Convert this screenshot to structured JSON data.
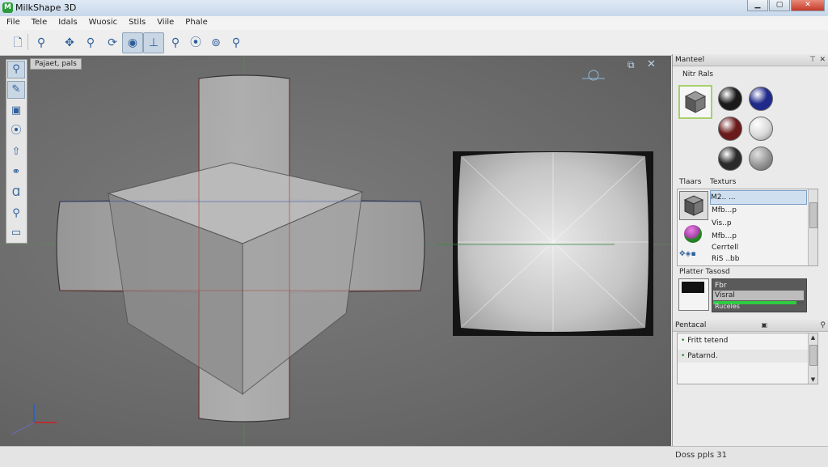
{
  "app": {
    "title": "MilkShape 3D",
    "logo": "M"
  },
  "window_buttons": {
    "minimize": "▁",
    "maximize": "▢",
    "close": "✕"
  },
  "menu": [
    "File",
    "Tele",
    "Idals",
    "Wuosic",
    "Stils",
    "Viile",
    "Phale"
  ],
  "toolbar": {
    "icons": [
      "new-file-icon",
      "select-icon",
      "move-icon",
      "search-icon",
      "rotate-icon",
      "scale-icon",
      "extrude-icon",
      "zoom-icon",
      "vertex-icon",
      "weld-icon",
      "magnify-icon"
    ]
  },
  "left_tools": {
    "icons": [
      "zoom-icon",
      "brush-icon",
      "face-icon",
      "vertex-icon",
      "arrow-icon",
      "joint-icon",
      "text-icon",
      "magnify-icon",
      "camera-icon"
    ]
  },
  "viewport": {
    "label": "Pajaet, pals",
    "axis_labels": {
      "x": "x",
      "y": "y",
      "z": "z"
    }
  },
  "materials_panel": {
    "header": "Manteel",
    "header_icons": [
      "pin-icon",
      "close-icon"
    ],
    "subheader": "Nitr Rals",
    "sphere_colors": [
      "#1a1a1a",
      "#1f2a8a",
      "#6a1a1a",
      "#d8d8d8",
      "#2a2a2a",
      "#9a9a9a"
    ]
  },
  "textures_panel": {
    "tabs": [
      "Tlaars",
      "Texturs"
    ],
    "items": [
      {
        "label": "M2.. ...",
        "selected": true
      },
      {
        "label": "Mfb...p",
        "selected": false
      },
      {
        "label": "Vis..p",
        "selected": false
      },
      {
        "label": "Mfb...p",
        "selected": false
      },
      {
        "label": "Cerrtell",
        "selected": false
      },
      {
        "label": "RiS ..bb",
        "selected": false
      }
    ]
  },
  "properties_panel": {
    "title": "Platter Tasosd",
    "rows": [
      {
        "label": "Fbr"
      },
      {
        "label": "Visral"
      },
      {
        "label": "Ruceles"
      }
    ],
    "bar_fill": 0.92,
    "bar_color": "#2ecc40"
  },
  "properties_section": {
    "header": "Pentacal",
    "items": [
      {
        "label": "Fritt tetend"
      },
      {
        "label": "Patarnd."
      }
    ]
  },
  "status": {
    "text": "Doss ppls 31"
  },
  "colors": {
    "accent": "#2f5f9a",
    "selection": "#c9d6e3"
  }
}
